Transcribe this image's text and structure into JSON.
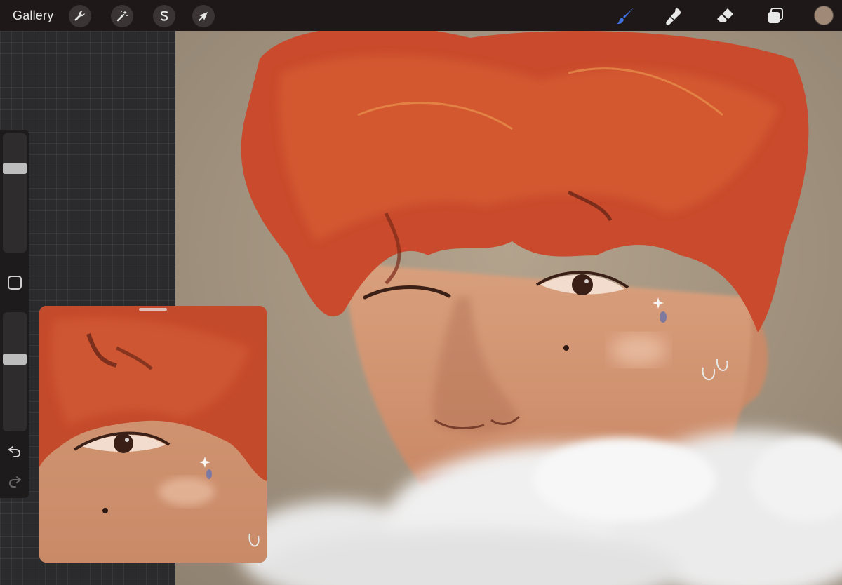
{
  "topbar": {
    "gallery_label": "Gallery",
    "actions": [
      {
        "icon": "wrench-icon",
        "name": "actions-button"
      },
      {
        "icon": "magic-wand-icon",
        "name": "adjustments-button"
      },
      {
        "icon": "selection-s-icon",
        "name": "selection-button"
      },
      {
        "icon": "arrow-cursor-icon",
        "name": "transform-button"
      }
    ],
    "tools": [
      {
        "icon": "brush-icon",
        "name": "paint-tool",
        "active": true
      },
      {
        "icon": "smudge-icon",
        "name": "smudge-tool"
      },
      {
        "icon": "eraser-icon",
        "name": "eraser-tool"
      },
      {
        "icon": "layers-icon",
        "name": "layers-button"
      }
    ],
    "current_color": "#a08977",
    "accent_color": "#3d6fe0"
  },
  "sidebar": {
    "brush_size_level": 0.27,
    "opacity_level": 0.38,
    "icons": [
      "modify-square-icon",
      "undo-icon",
      "redo-icon"
    ]
  },
  "reference_window": {
    "visible": true
  }
}
